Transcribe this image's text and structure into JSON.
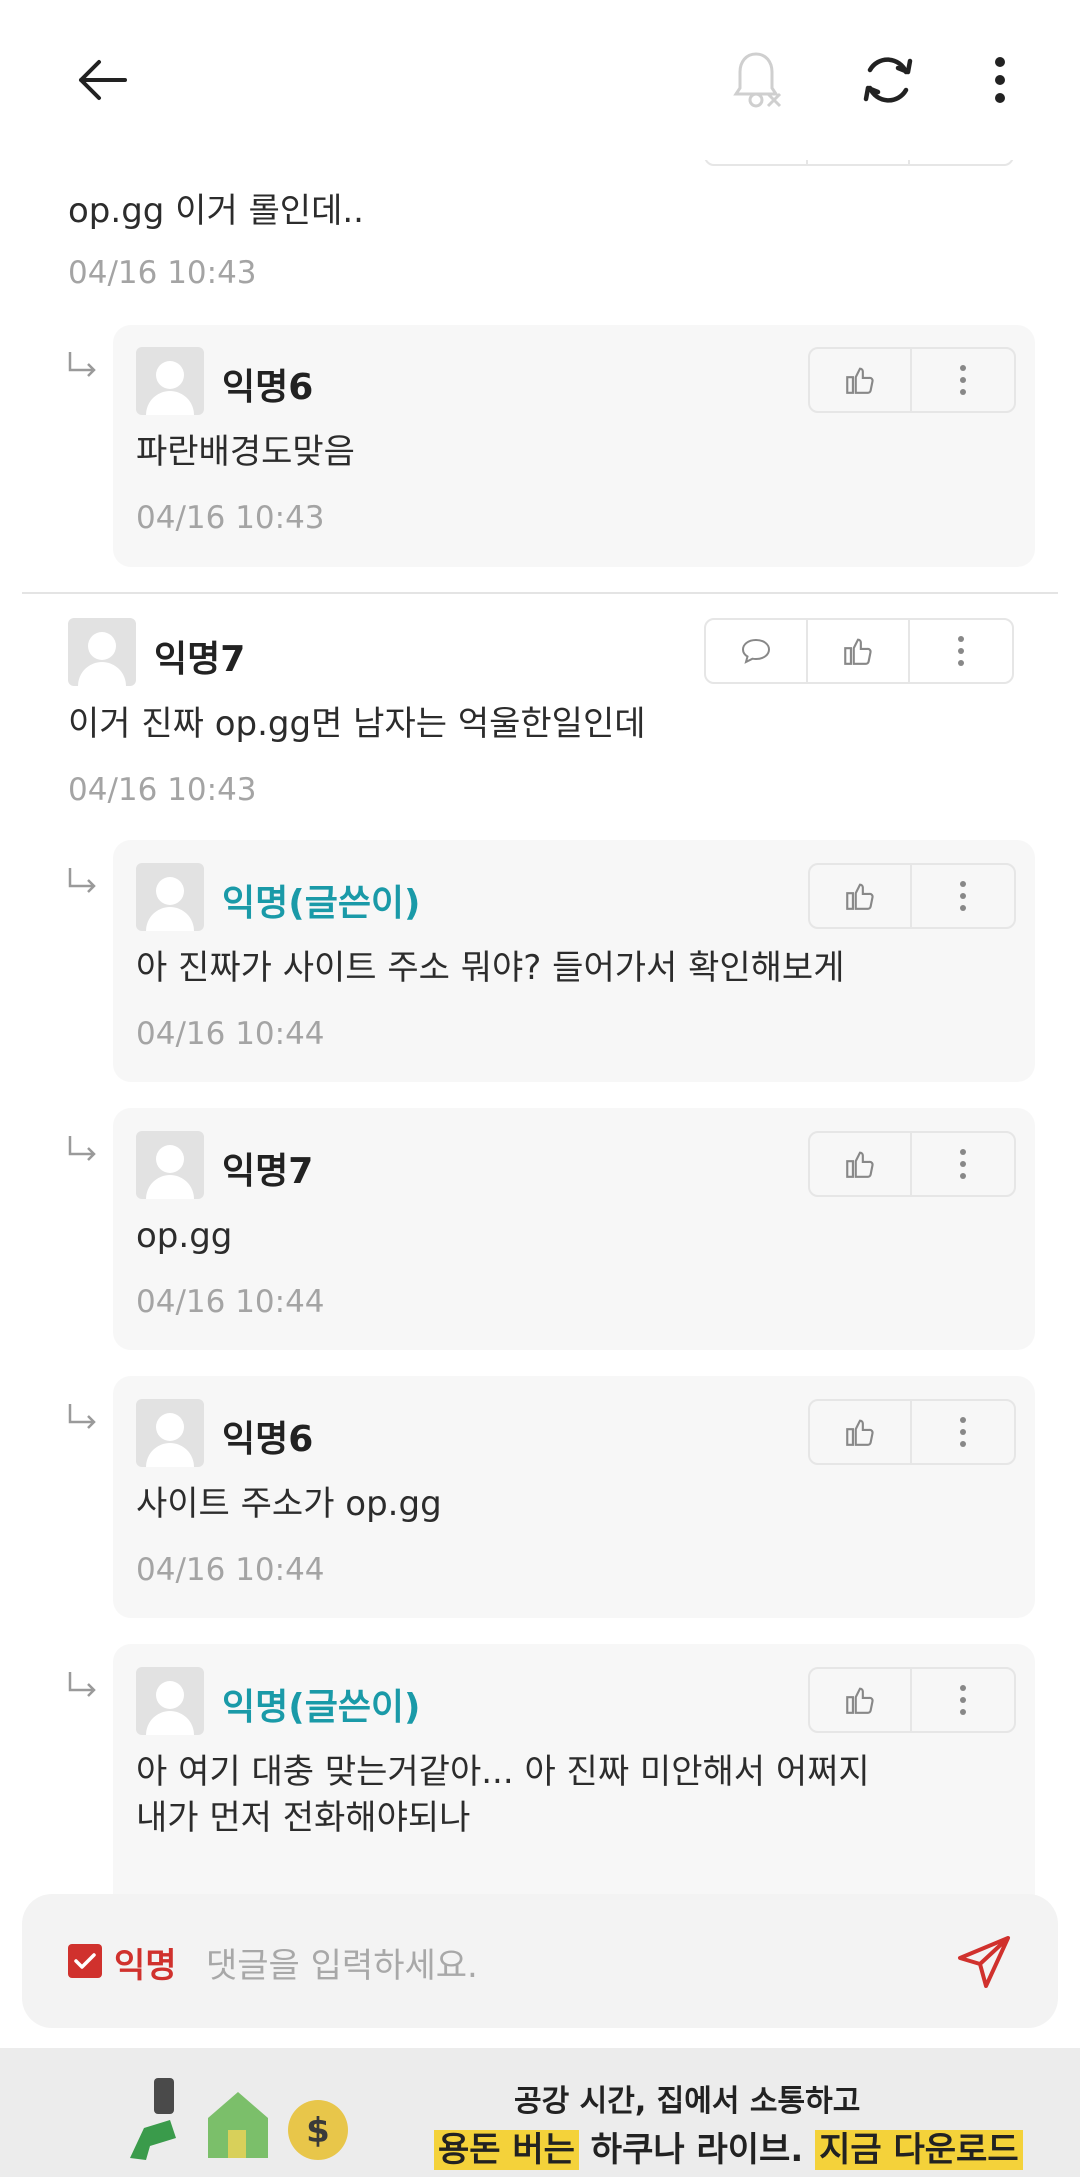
{
  "header": {
    "back_icon": "arrow-left-icon",
    "notify_icon": "bell-off-icon",
    "refresh_icon": "refresh-icon",
    "more_icon": "more-vertical-icon"
  },
  "comments": [
    {
      "type": "comment",
      "text": "op.gg 이거 롤인데..",
      "time": "04/16 10:43"
    },
    {
      "type": "reply",
      "author": "익명6",
      "text": "파란배경도맞음",
      "time": "04/16 10:43"
    },
    {
      "type": "comment",
      "author": "익명7",
      "text": "이거 진짜 op.gg면 남자는 억울한일인데",
      "time": "04/16 10:43"
    },
    {
      "type": "reply",
      "author": "익명(글쓴이)",
      "is_op": true,
      "text": "아 진짜가 사이트 주소 뭐야? 들어가서 확인해보게",
      "time": "04/16 10:44"
    },
    {
      "type": "reply",
      "author": "익명7",
      "text": "op.gg",
      "time": "04/16 10:44"
    },
    {
      "type": "reply",
      "author": "익명6",
      "text": "사이트 주소가 op.gg",
      "time": "04/16 10:44"
    },
    {
      "type": "reply",
      "author": "익명(글쓴이)",
      "is_op": true,
      "text_line1": "아 여기 대충 맞는거같아... 아 진짜 미안해서 어쩌지",
      "text_line2": "내가 먼저 전화해야되나"
    }
  ],
  "input": {
    "anonymous_label": "익명",
    "anonymous_checked": true,
    "placeholder": "댓글을 입력하세요."
  },
  "ad": {
    "line1": "공강 시간, 집에서 소통하고",
    "line2_a": "용돈 버는",
    "line2_b": " 하쿠나 라이브. ",
    "line2_c": "지금 다운로드"
  },
  "colors": {
    "op_name": "#1a9aa8",
    "accent_red": "#d0312d",
    "reply_bg": "#f7f7f7",
    "time_gray": "#a4a4a4"
  }
}
